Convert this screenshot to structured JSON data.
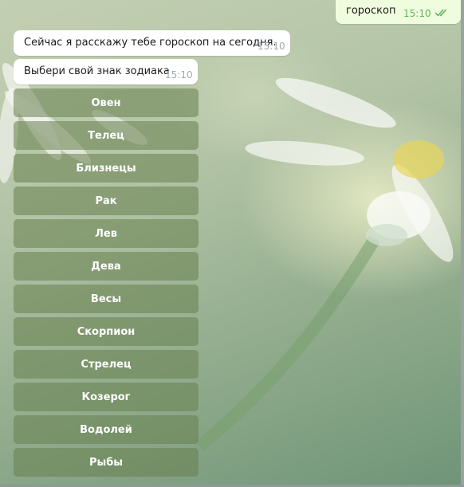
{
  "messages": {
    "outgoing": {
      "text": "гороскоп",
      "time": "15:10",
      "status_icon": "double-check-icon"
    },
    "incoming": [
      {
        "text": "Сейчас я расскажу тебе гороскоп на сегодня.",
        "time": "15:10"
      },
      {
        "text": "Выбери свой знак зодиака",
        "time": "15:10"
      }
    ]
  },
  "keyboard": {
    "buttons": [
      "Овен",
      "Телец",
      "Близнецы",
      "Рак",
      "Лев",
      "Дева",
      "Весы",
      "Скорпион",
      "Стрелец",
      "Козерог",
      "Водолей",
      "Рыбы"
    ]
  },
  "colors": {
    "incoming_bubble": "#ffffff",
    "outgoing_bubble": "#effdde",
    "keyboard_button": "#68804e",
    "check_color": "#5fb35a"
  }
}
